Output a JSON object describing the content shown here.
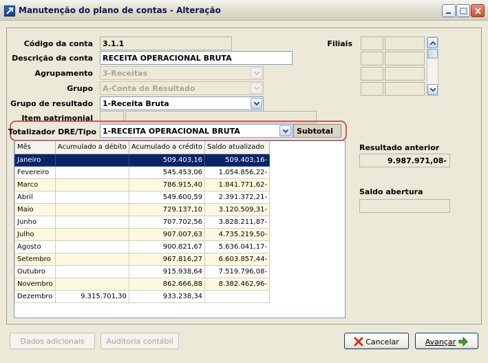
{
  "window": {
    "title": "Manutenção do plano de contas - Alteração"
  },
  "form": {
    "codigo": {
      "label": "Código da conta",
      "value": "3.1.1"
    },
    "descricao": {
      "label": "Descrição da conta",
      "value": "RECEITA OPERACIONAL BRUTA"
    },
    "agrupamento": {
      "label": "Agrupamento",
      "value": "3-Receitas"
    },
    "grupo": {
      "label": "Grupo",
      "value": "A-Conta de Resultado"
    },
    "grupo_resultado": {
      "label": "Grupo de resultado",
      "value": "1-Receita Bruta"
    },
    "item_patrimonial": {
      "label": "Item patrimonial"
    },
    "totalizador": {
      "label": "Totalizador DRE/Tipo",
      "value": "1-RECEITA OPERACIONAL BRUTA",
      "tipo": "Subtotal"
    },
    "filiais": {
      "label": "Filiais"
    }
  },
  "table": {
    "headers": [
      "Mês",
      "Acumulado a débito",
      "Acumulado a crédito",
      "Saldo atualizado"
    ],
    "rows": [
      [
        "Janeiro",
        "",
        "509.403,16",
        "509.403,16-"
      ],
      [
        "Fevereiro",
        "",
        "545.453,06",
        "1.054.856,22-"
      ],
      [
        "Marco",
        "",
        "786.915,40",
        "1.841.771,62-"
      ],
      [
        "Abril",
        "",
        "549.600,59",
        "2.391.372,21-"
      ],
      [
        "Maio",
        "",
        "729.137,10",
        "3.120.509,31-"
      ],
      [
        "Junho",
        "",
        "707.702,56",
        "3.828.211,87-"
      ],
      [
        "Julho",
        "",
        "907.007,63",
        "4.735.219,50-"
      ],
      [
        "Agosto",
        "",
        "900.821,67",
        "5.636.041,17-"
      ],
      [
        "Setembro",
        "",
        "967.816,27",
        "6.603.857,44-"
      ],
      [
        "Outubro",
        "",
        "915.938,64",
        "7.519.796,08-"
      ],
      [
        "Novembro",
        "",
        "862.666,88",
        "8.382.462,96-"
      ],
      [
        "Dezembro",
        "9.315.701,30",
        "933.238,34",
        ""
      ]
    ],
    "selected_row": 0
  },
  "side": {
    "resultado_anterior": {
      "label": "Resultado anterior",
      "value": "9.987.971,08-"
    },
    "saldo_abertura": {
      "label": "Saldo abertura",
      "value": ""
    }
  },
  "buttons": {
    "dados_adicionais": "Dados adicionais",
    "auditoria": "Auditoria contábil",
    "cancelar": "Cancelar",
    "avancar": "Avançar"
  },
  "colors": {
    "selection": "#0a246a",
    "highlight_ring": "#d35454",
    "row_alt": "#fbf9df"
  }
}
